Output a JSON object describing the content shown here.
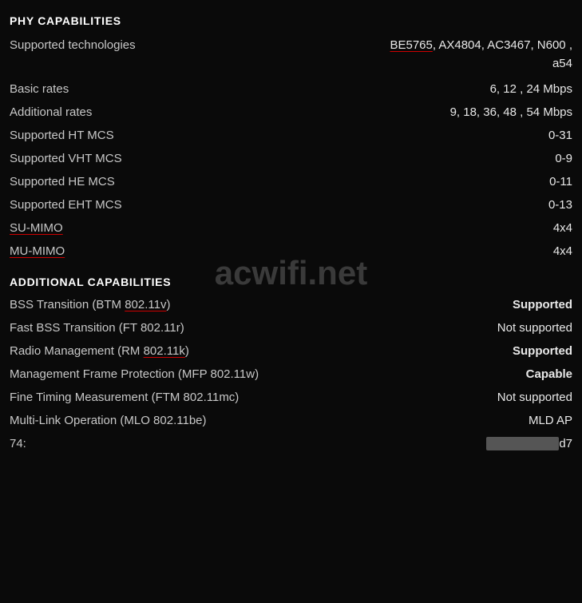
{
  "sections": [
    {
      "id": "phy-capabilities",
      "header": "PHY CAPABILITIES",
      "rows": [
        {
          "id": "supported-tech",
          "label": "Supported technologies",
          "value": "BE5765, AX4804, AC3467, N600 ,\na54",
          "value_parts": [
            "BE5765",
            ", AX4804, AC3467, N600 ,",
            "\na54"
          ],
          "underline_first": true
        },
        {
          "id": "basic-rates",
          "label": "Basic rates",
          "value": "6, 12 , 24 Mbps"
        },
        {
          "id": "additional-rates",
          "label": "Additional rates",
          "value": "9, 18, 36, 48 , 54 Mbps"
        },
        {
          "id": "ht-mcs",
          "label": "Supported HT MCS",
          "value": "0-31"
        },
        {
          "id": "vht-mcs",
          "label": "Supported VHT MCS",
          "value": "0-9"
        },
        {
          "id": "he-mcs",
          "label": "Supported HE MCS",
          "value": "0-11"
        },
        {
          "id": "eht-mcs",
          "label": "Supported EHT MCS",
          "value": "0-13"
        },
        {
          "id": "su-mimo",
          "label": "SU-MIMO",
          "label_underline": true,
          "value": "4x4"
        },
        {
          "id": "mu-mimo",
          "label": "MU-MIMO",
          "label_underline": true,
          "value": "4x4"
        }
      ]
    },
    {
      "id": "additional-capabilities",
      "header": "ADDITIONAL CAPABILITIES",
      "rows": [
        {
          "id": "bss-transition",
          "label": "BSS Transition (BTM 802.11v)",
          "label_underline_part": "802.11v",
          "value": "Supported",
          "value_bold": true
        },
        {
          "id": "fast-bss",
          "label": "Fast BSS Transition (FT 802.11r)",
          "value": "Not supported"
        },
        {
          "id": "radio-mgmt",
          "label": "Radio Management (RM 802.11k)",
          "label_underline_part": "802.11k",
          "value": "Supported",
          "value_bold": true
        },
        {
          "id": "mfp",
          "label": "Management Frame Protection (MFP 802.11w)",
          "value": "Capable",
          "value_bold": true
        },
        {
          "id": "ftm",
          "label": "Fine Timing Measurement (FTM 802.11mc)",
          "value": "Not supported"
        },
        {
          "id": "mlo",
          "label": "Multi-Link Operation (MLO 802.11be)",
          "value": "MLD AP"
        },
        {
          "id": "last-row",
          "label": "74:",
          "value": "d7",
          "censored": true
        }
      ]
    }
  ],
  "watermark": "acwifi.net"
}
